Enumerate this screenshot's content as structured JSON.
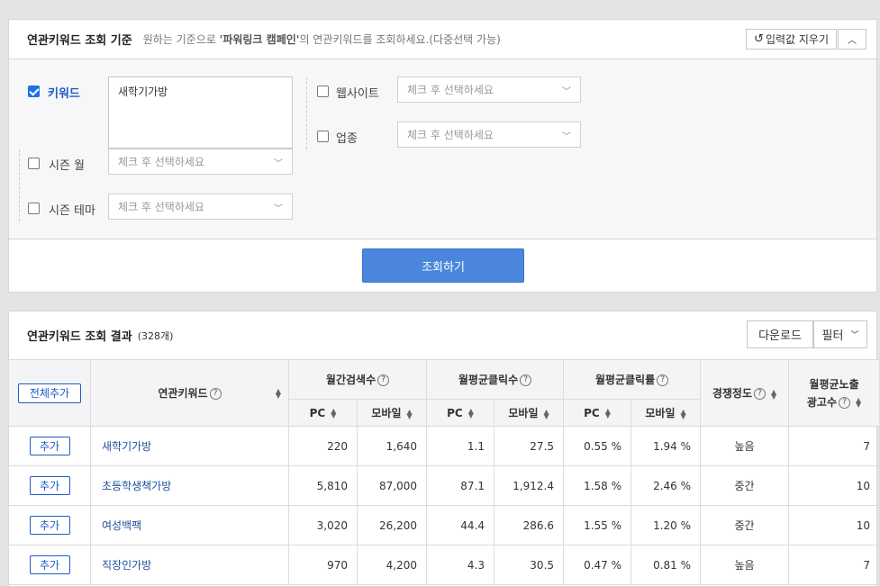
{
  "criteria": {
    "title": "연관키워드 조회 기준",
    "desc_prefix": "원하는 기준으로",
    "desc_highlight": "'파워링크 캠페인'",
    "desc_suffix": "의 연관키워드를 조회하세요.(다중선택 가능)",
    "reset_label": "입력값 지우기",
    "keyword": {
      "label": "키워드",
      "checked": true,
      "value": "새학기가방"
    },
    "website": {
      "label": "웹사이트",
      "checked": false,
      "placeholder": "체크 후 선택하세요"
    },
    "industry": {
      "label": "업종",
      "checked": false,
      "placeholder": "체크 후 선택하세요"
    },
    "season_month": {
      "label": "시즌 월",
      "checked": false,
      "placeholder": "체크 후 선택하세요"
    },
    "season_theme": {
      "label": "시즌 테마",
      "checked": false,
      "placeholder": "체크 후 선택하세요"
    },
    "search_label": "조회하기"
  },
  "results": {
    "title": "연관키워드 조회 결과",
    "count": "(328개)",
    "download_label": "다운로드",
    "filter_label": "필터",
    "add_all_label": "전체추가",
    "add_label": "추가",
    "headers": {
      "keyword": "연관키워드",
      "monthly_search": "월간검색수",
      "avg_clicks": "월평균클릭수",
      "avg_ctr": "월평균클릭률",
      "competition": "경쟁정도",
      "avg_ads_line1": "월평균노출",
      "avg_ads_line2": "광고수",
      "pc": "PC",
      "mobile": "모바일"
    },
    "rows": [
      {
        "keyword": "새학기가방",
        "pc_search": "220",
        "mobile_search": "1,640",
        "pc_clicks": "1.1",
        "mobile_clicks": "27.5",
        "pc_ctr": "0.55 %",
        "mobile_ctr": "1.94 %",
        "competition": "높음",
        "ads": "7"
      },
      {
        "keyword": "초등학생책가방",
        "pc_search": "5,810",
        "mobile_search": "87,000",
        "pc_clicks": "87.1",
        "mobile_clicks": "1,912.4",
        "pc_ctr": "1.58 %",
        "mobile_ctr": "2.46 %",
        "competition": "중간",
        "ads": "10"
      },
      {
        "keyword": "여성백팩",
        "pc_search": "3,020",
        "mobile_search": "26,200",
        "pc_clicks": "44.4",
        "mobile_clicks": "286.6",
        "pc_ctr": "1.55 %",
        "mobile_ctr": "1.20 %",
        "competition": "중간",
        "ads": "10"
      },
      {
        "keyword": "직장인가방",
        "pc_search": "970",
        "mobile_search": "4,200",
        "pc_clicks": "4.3",
        "mobile_clicks": "30.5",
        "pc_ctr": "0.47 %",
        "mobile_ctr": "0.81 %",
        "competition": "높음",
        "ads": "7"
      }
    ]
  }
}
